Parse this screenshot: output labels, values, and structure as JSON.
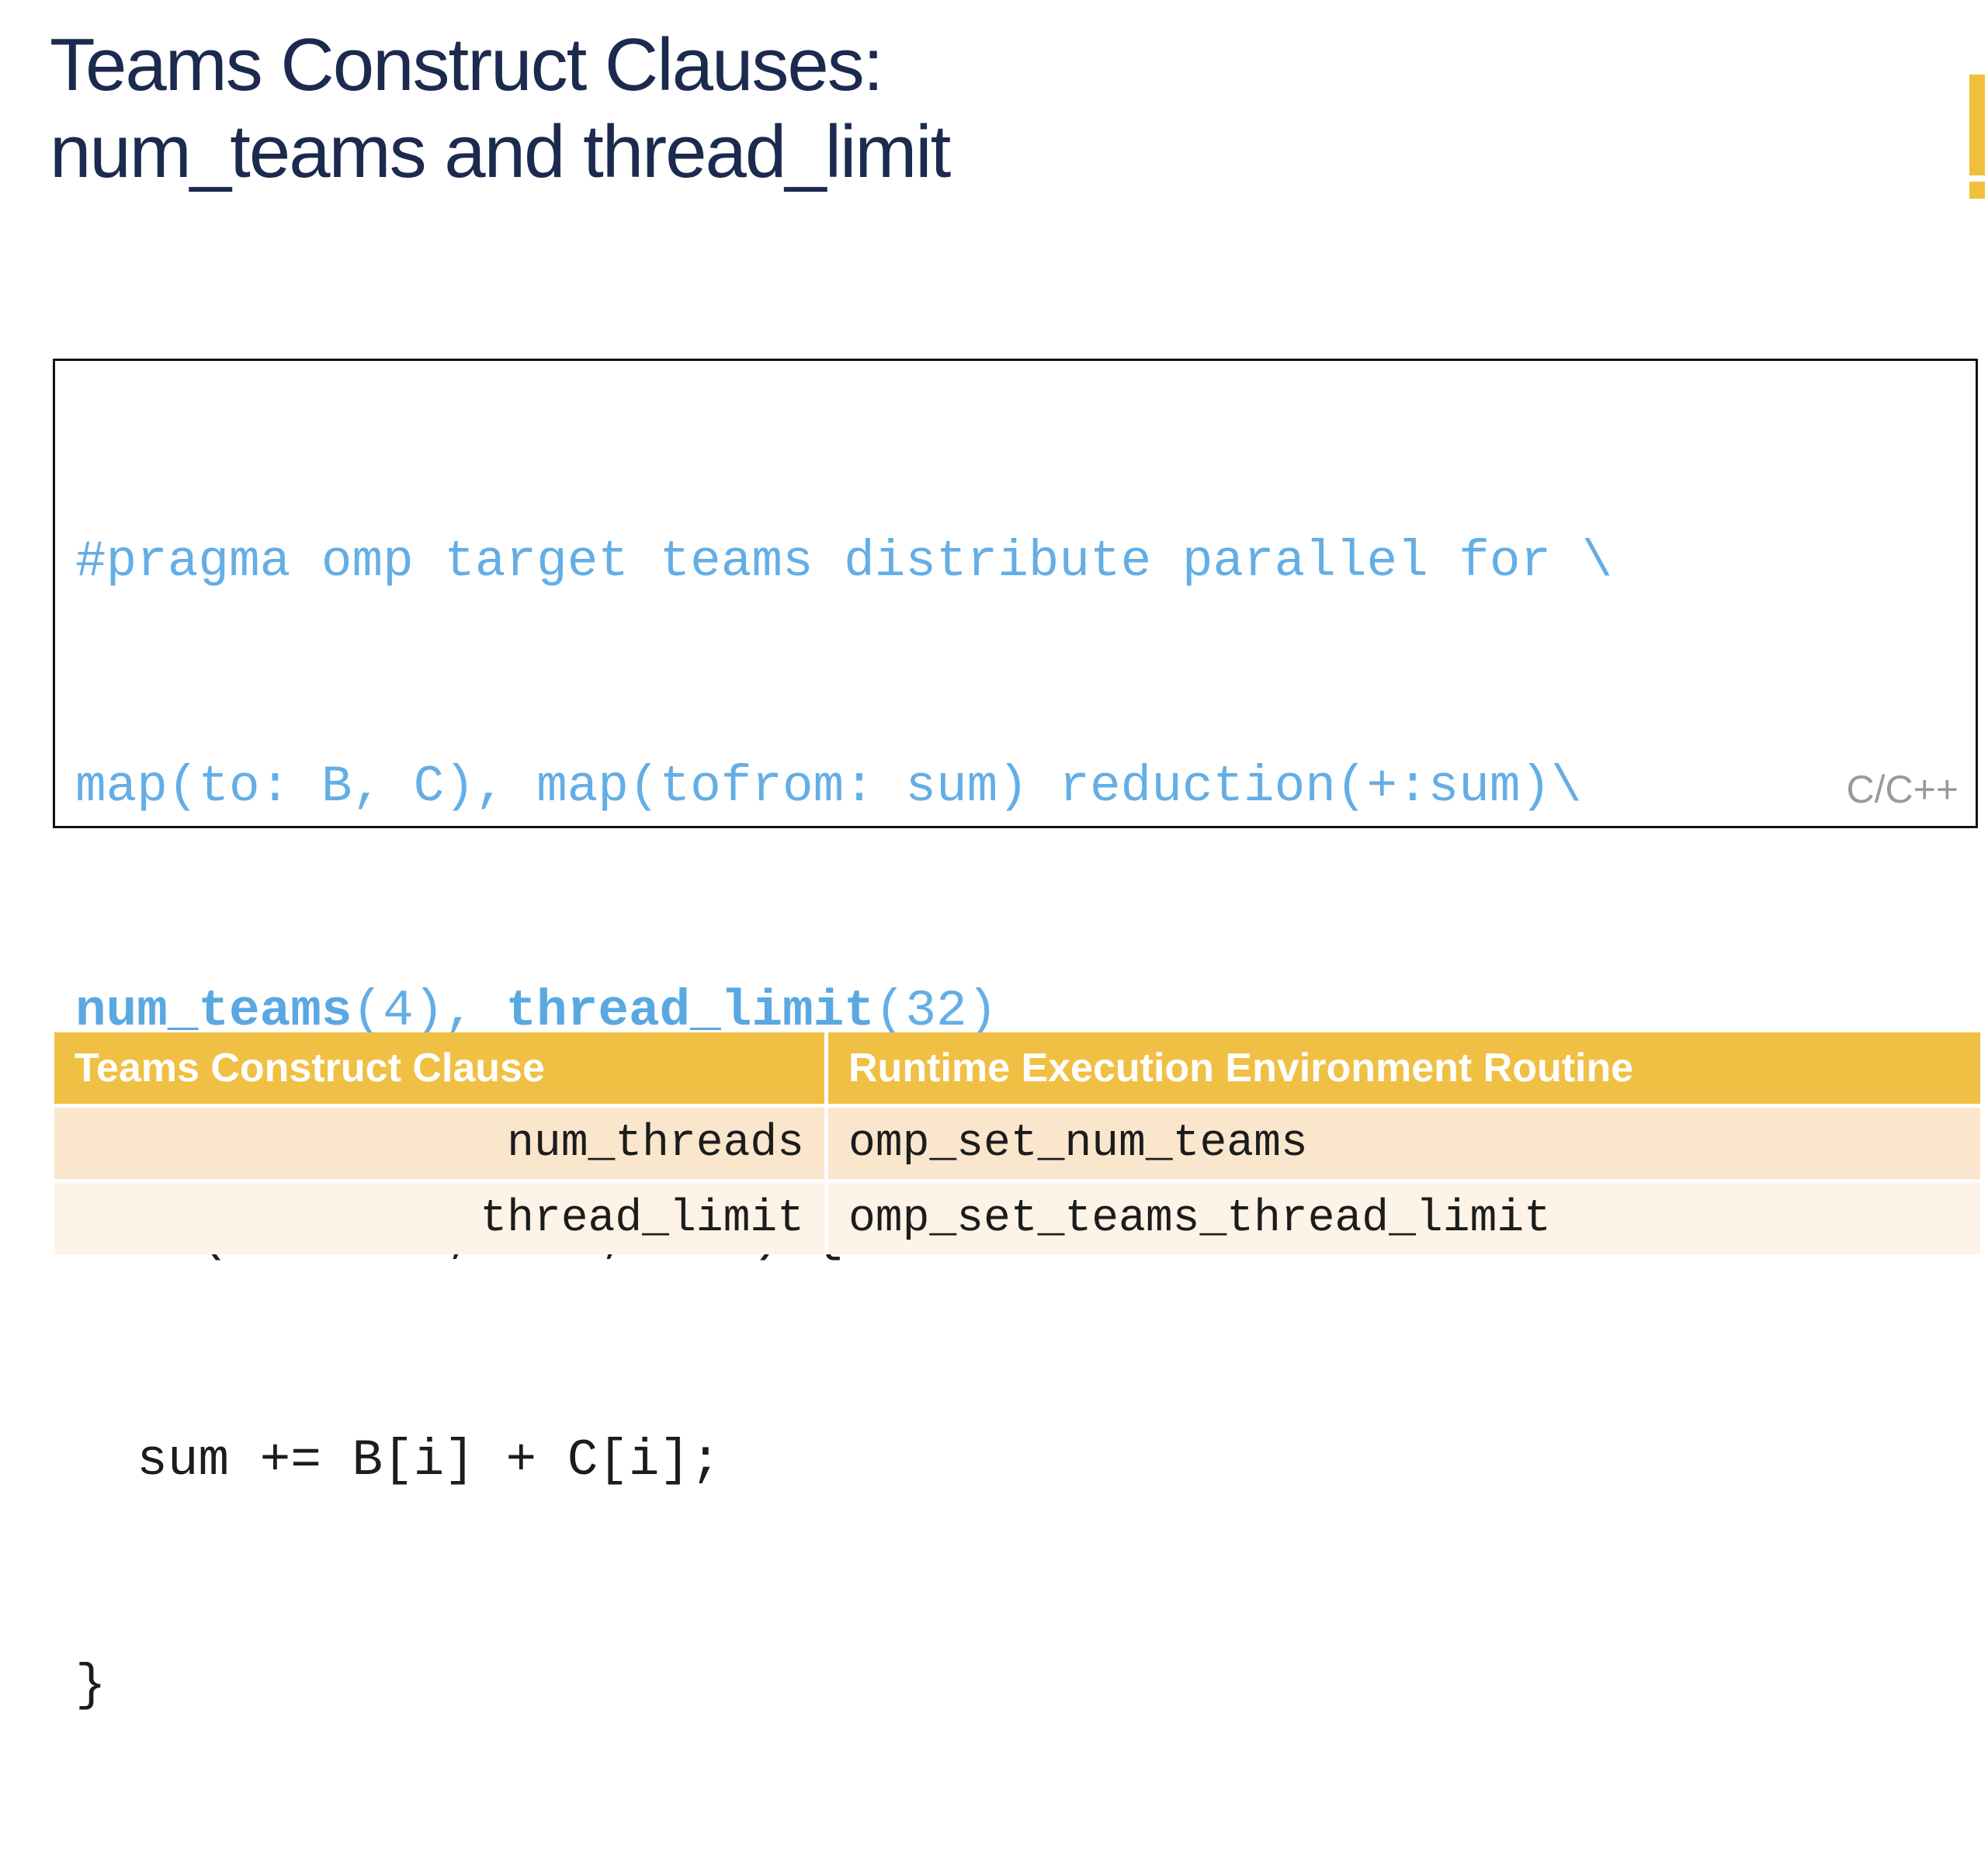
{
  "slide": {
    "title_line1": "Teams Construct Clauses:",
    "title_line2": "num_teams and thread_limit"
  },
  "code": {
    "line1": "#pragma omp target teams distribute parallel for \\",
    "line2": "map(to: B, C), map(tofrom: sum) reduction(+:sum)\\",
    "line3_kw1": "num_teams",
    "line3_arg1": "(4), ",
    "line3_kw2": "thread_limit",
    "line3_arg2": "(32)",
    "line4_kw": "for",
    "line4_rest": " (int i=0; i<N; i++) {",
    "line5": "  sum += B[i] + C[i];",
    "line6": "}",
    "language": "C/C++"
  },
  "table": {
    "headers": [
      "Teams Construct Clause",
      "Runtime Execution Environment Routine"
    ],
    "rows": [
      [
        "num_threads",
        "omp_set_num_teams"
      ],
      [
        "thread_limit",
        "omp_set_teams_thread_limit"
      ]
    ]
  },
  "colors": {
    "title": "#1b2a4e",
    "accent": "#f0c044",
    "pragma": "#64aee6",
    "keyword_for": "#6b3fa0"
  }
}
